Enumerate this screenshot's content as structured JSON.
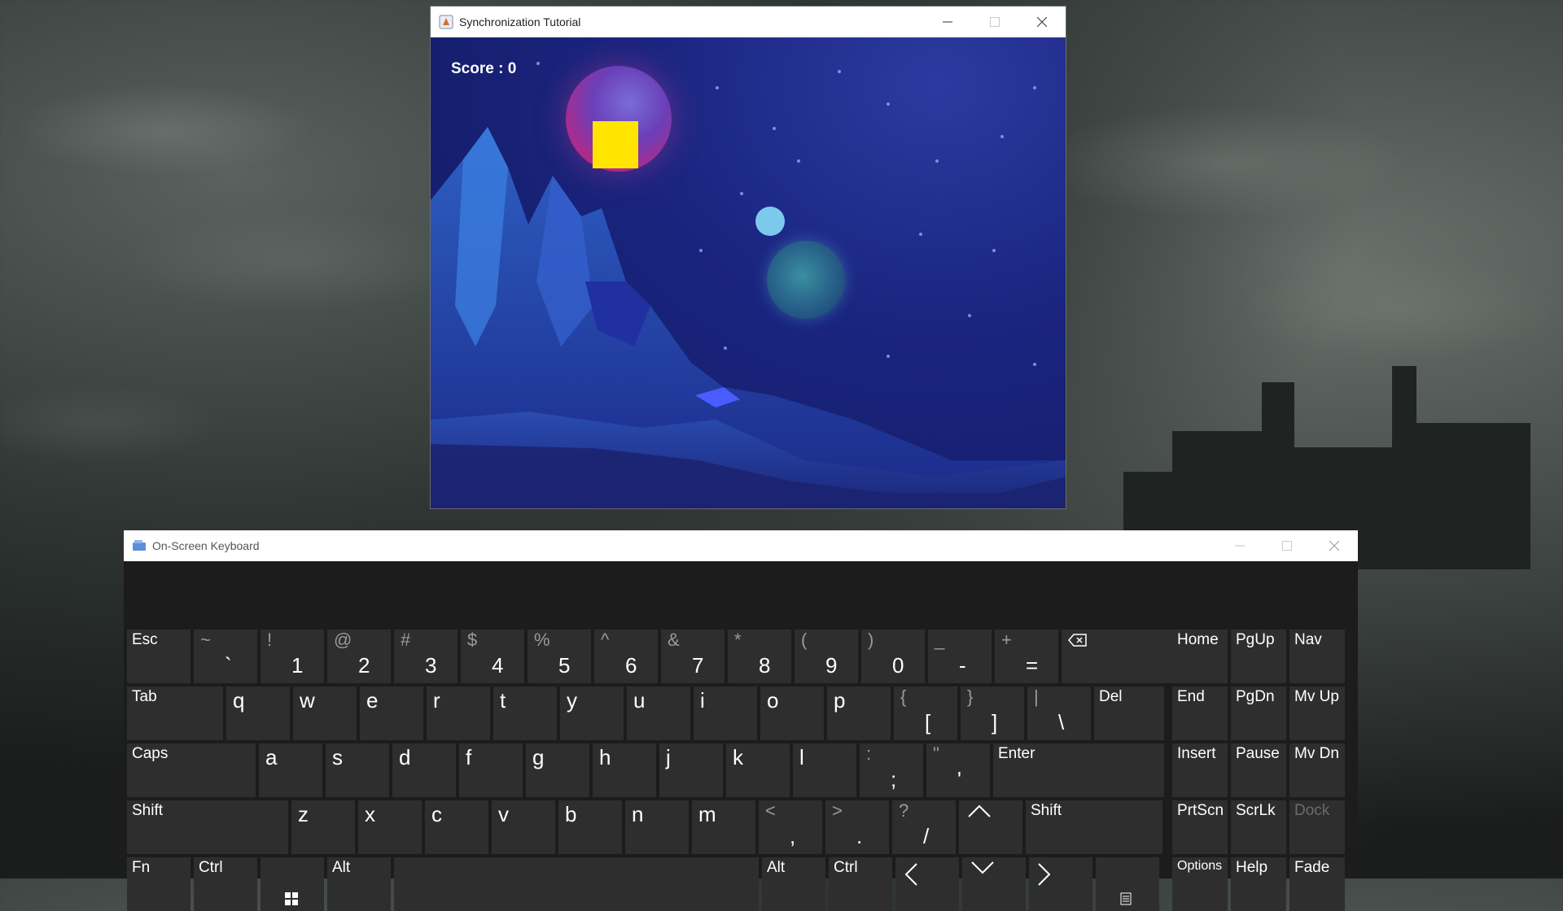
{
  "game_window": {
    "title": "Synchronization Tutorial",
    "score_text": "Score : 0"
  },
  "osk": {
    "title": "On-Screen Keyboard",
    "row1": [
      {
        "name": "esc",
        "main": "Esc"
      },
      {
        "name": "backtick",
        "shift": "~",
        "base": "`"
      },
      {
        "name": "1",
        "shift": "!",
        "base": "1"
      },
      {
        "name": "2",
        "shift": "@",
        "base": "2"
      },
      {
        "name": "3",
        "shift": "#",
        "base": "3"
      },
      {
        "name": "4",
        "shift": "$",
        "base": "4"
      },
      {
        "name": "5",
        "shift": "%",
        "base": "5"
      },
      {
        "name": "6",
        "shift": "^",
        "base": "6"
      },
      {
        "name": "7",
        "shift": "&",
        "base": "7"
      },
      {
        "name": "8",
        "shift": "*",
        "base": "8"
      },
      {
        "name": "9",
        "shift": "(",
        "base": "9"
      },
      {
        "name": "0",
        "shift": ")",
        "base": "0"
      },
      {
        "name": "minus",
        "shift": "_",
        "base": "-"
      },
      {
        "name": "equals",
        "shift": "+",
        "base": "="
      },
      {
        "name": "backspace",
        "icon": "backspace-icon"
      }
    ],
    "row2": [
      {
        "name": "tab",
        "main": "Tab"
      },
      {
        "name": "q",
        "letter": "q"
      },
      {
        "name": "w",
        "letter": "w"
      },
      {
        "name": "e",
        "letter": "e"
      },
      {
        "name": "r",
        "letter": "r"
      },
      {
        "name": "t",
        "letter": "t"
      },
      {
        "name": "y",
        "letter": "y"
      },
      {
        "name": "u",
        "letter": "u"
      },
      {
        "name": "i",
        "letter": "i"
      },
      {
        "name": "o",
        "letter": "o"
      },
      {
        "name": "p",
        "letter": "p"
      },
      {
        "name": "lbracket",
        "shift": "{",
        "base": "["
      },
      {
        "name": "rbracket",
        "shift": "}",
        "base": "]"
      },
      {
        "name": "backslash",
        "shift": "|",
        "base": "\\"
      },
      {
        "name": "del",
        "main": "Del"
      }
    ],
    "row3": [
      {
        "name": "caps",
        "main": "Caps"
      },
      {
        "name": "a",
        "letter": "a"
      },
      {
        "name": "s",
        "letter": "s"
      },
      {
        "name": "d",
        "letter": "d"
      },
      {
        "name": "f",
        "letter": "f"
      },
      {
        "name": "g",
        "letter": "g"
      },
      {
        "name": "h",
        "letter": "h"
      },
      {
        "name": "j",
        "letter": "j"
      },
      {
        "name": "k",
        "letter": "k"
      },
      {
        "name": "l",
        "letter": "l"
      },
      {
        "name": "semicolon",
        "shift": ":",
        "base": ";"
      },
      {
        "name": "quote",
        "shift": "\"",
        "base": "'"
      },
      {
        "name": "enter",
        "main": "Enter"
      }
    ],
    "row4": [
      {
        "name": "lshift",
        "main": "Shift"
      },
      {
        "name": "z",
        "letter": "z"
      },
      {
        "name": "x",
        "letter": "x"
      },
      {
        "name": "c",
        "letter": "c"
      },
      {
        "name": "v",
        "letter": "v"
      },
      {
        "name": "b",
        "letter": "b"
      },
      {
        "name": "n",
        "letter": "n"
      },
      {
        "name": "m",
        "letter": "m"
      },
      {
        "name": "comma",
        "shift": "<",
        "base": ","
      },
      {
        "name": "period",
        "shift": ">",
        "base": "."
      },
      {
        "name": "slash",
        "shift": "?",
        "base": "/"
      },
      {
        "name": "up",
        "icon": "arrow-up-icon"
      },
      {
        "name": "rshift",
        "main": "Shift"
      }
    ],
    "row5": [
      {
        "name": "fn",
        "main": "Fn"
      },
      {
        "name": "lctrl",
        "main": "Ctrl"
      },
      {
        "name": "win",
        "icon": "windows-icon"
      },
      {
        "name": "lalt",
        "main": "Alt"
      },
      {
        "name": "space",
        "main": ""
      },
      {
        "name": "ralt",
        "main": "Alt"
      },
      {
        "name": "rctrl",
        "main": "Ctrl"
      },
      {
        "name": "left",
        "icon": "arrow-left-icon"
      },
      {
        "name": "down",
        "icon": "arrow-down-icon"
      },
      {
        "name": "right",
        "icon": "arrow-right-icon"
      },
      {
        "name": "menu",
        "icon": "context-menu-icon"
      }
    ],
    "nav_keys": [
      [
        "Home",
        "PgUp",
        "Nav"
      ],
      [
        "End",
        "PgDn",
        "Mv Up"
      ],
      [
        "Insert",
        "Pause",
        "Mv Dn"
      ],
      [
        "PrtScn",
        "ScrLk",
        "Dock"
      ],
      [
        "Options",
        "Help",
        "Fade"
      ]
    ],
    "dimmed_keys": [
      "Dock"
    ]
  }
}
